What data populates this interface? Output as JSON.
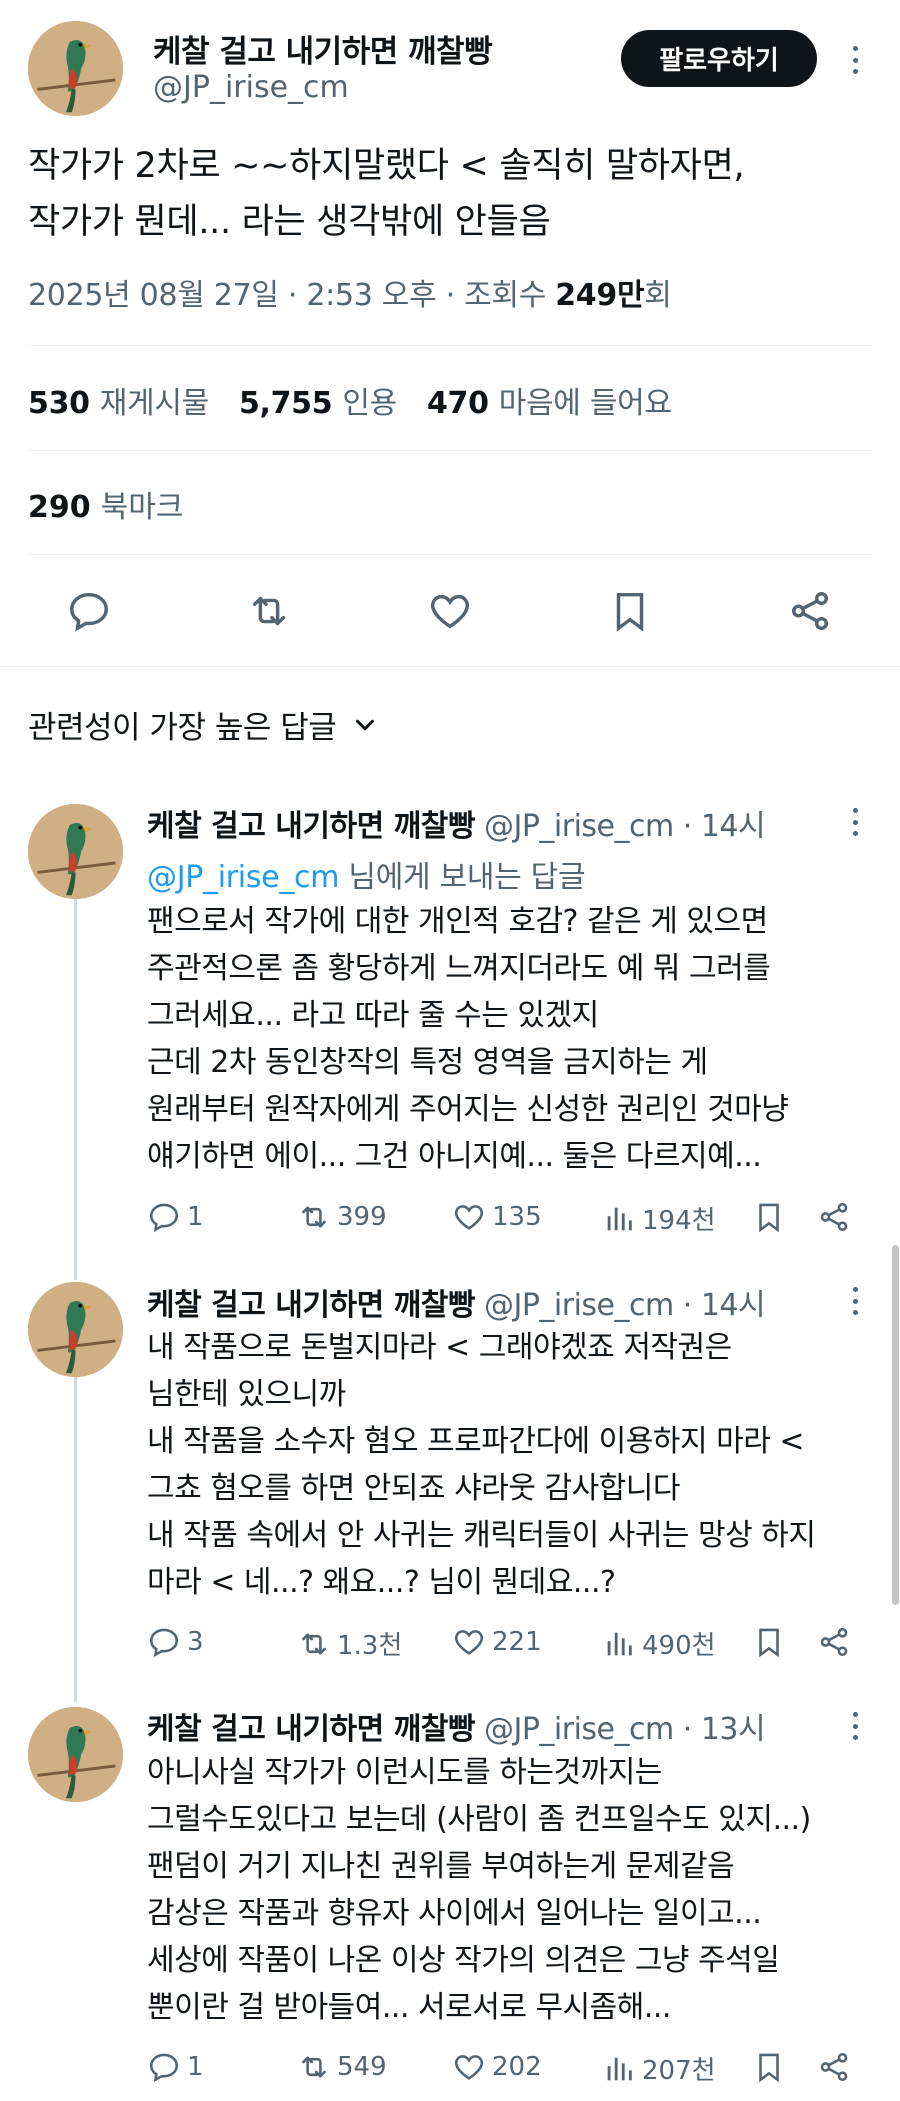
{
  "main_tweet": {
    "author_name": "케찰 걸고 내기하면 깨찰빵",
    "author_handle": "@JP_irise_cm",
    "follow_label": "팔로우하기",
    "text_lines": [
      "작가가 2차로 ~~하지말랬다 < 솔직히 말하자면,",
      "작가가 뭔데... 라는 생각밖에 안들음"
    ],
    "meta_date": "2025년 08월 27일 · 2:53 오후 · 조회수 ",
    "meta_views": "249만",
    "meta_views_suffix": "회",
    "stats": {
      "reposts_count": "530",
      "reposts_label": "재게시물",
      "quotes_count": "5,755",
      "quotes_label": "인용",
      "likes_count": "470",
      "likes_label": "마음에 들어요",
      "bookmarks_count": "290",
      "bookmarks_label": "북마크"
    }
  },
  "sort_label": "관련성이 가장 높은 답글",
  "replies": [
    {
      "author_name": "케찰 걸고 내기하면 깨찰빵",
      "author_handle": "@JP_irise_cm",
      "time": " · 14시",
      "reply_to_mention": "@JP_irise_cm",
      "reply_to_suffix": " 님에게 보내는 답글",
      "lines": [
        "팬으로서 작가에 대한 개인적 호감? 같은 게 있으면",
        "주관적으론 좀 황당하게 느껴지더라도 예 뭐 그러를",
        "그러세요... 라고 따라 줄 수는 있겠지",
        "근데 2차 동인창작의 특정 영역을 금지하는 게",
        "원래부터 원작자에게 주어지는 신성한 권리인 것마냥",
        "얘기하면 에이... 그건 아니지예... 둘은 다르지예..."
      ],
      "replies": "1",
      "reposts": "399",
      "likes": "135",
      "views": "194천"
    },
    {
      "author_name": "케찰 걸고 내기하면 깨찰빵",
      "author_handle": "@JP_irise_cm",
      "time": " · 14시",
      "lines": [
        "내 작품으로 돈벌지마라 < 그래야겠죠 저작권은",
        "님한테 있으니까",
        "내 작품을 소수자 혐오 프로파간다에 이용하지 마라 <",
        "그쵸 혐오를 하면 안되죠 샤라웃 감사합니다",
        "내 작품 속에서 안 사귀는 캐릭터들이 사귀는 망상 하지",
        "마라 < 네...? 왜요...? 님이 뭔데요...?"
      ],
      "replies": "3",
      "reposts": "1.3천",
      "likes": "221",
      "views": "490천"
    },
    {
      "author_name": "케찰 걸고 내기하면 깨찰빵",
      "author_handle": "@JP_irise_cm",
      "time": " · 13시",
      "lines": [
        "아니사실 작가가 이런시도를 하는것까지는",
        "그럴수도있다고 보는데 (사람이 좀 컨프일수도 있지...)",
        "팬덤이 거기 지나친 권위를 부여하는게 문제같음",
        "감상은 작품과 향유자 사이에서 일어나는 일이고...",
        "세상에 작품이 나온 이상 작가의 의견은 그냥 주석일",
        "뿐이란 걸 받아들여... 서로서로 무시좀해..."
      ],
      "replies": "1",
      "reposts": "549",
      "likes": "202",
      "views": "207천"
    }
  ],
  "colors": {
    "text": "#0f1419",
    "secondary": "#536471",
    "link": "#1d9bf0",
    "border": "#eff3f4"
  }
}
